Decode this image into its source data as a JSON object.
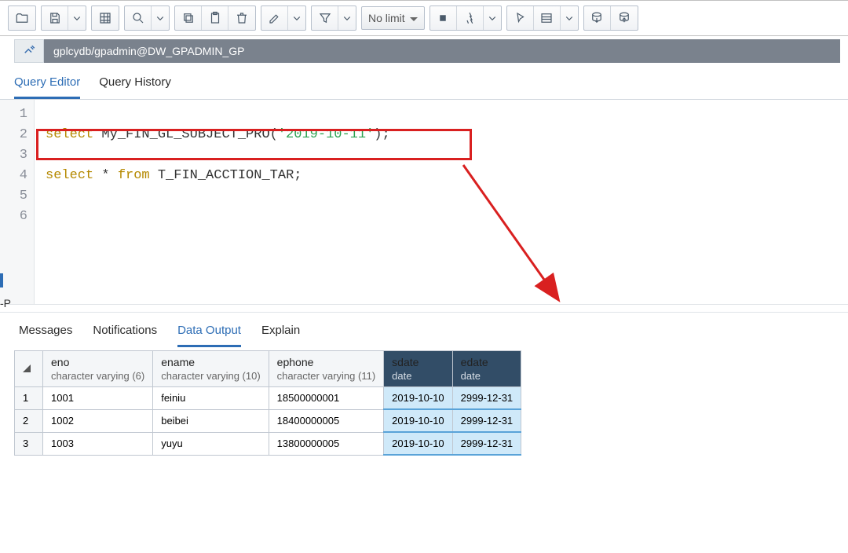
{
  "toolbar": {
    "limit_label": "No limit"
  },
  "connection": {
    "path": "gplcydb/gpadmin@DW_GPADMIN_GP"
  },
  "query_tabs": {
    "editor": "Query Editor",
    "history": "Query History"
  },
  "editor": {
    "lines": [
      "1",
      "2",
      "3",
      "4",
      "5",
      "6"
    ],
    "line2": {
      "kw": "select",
      "fn": " My_FIN_GL_SUBJECT_PRO(",
      "arg": "'2019-10-11'",
      "end": ");"
    },
    "line4": {
      "kw1": "select",
      "mid": " * ",
      "kw2": "from",
      "tbl": " T_FIN_ACCTION_TAR;"
    }
  },
  "result_tabs": {
    "messages": "Messages",
    "notifications": "Notifications",
    "data_output": "Data Output",
    "explain": "Explain"
  },
  "columns": [
    {
      "name": "eno",
      "type": "character varying (6)",
      "selected": false
    },
    {
      "name": "ename",
      "type": "character varying (10)",
      "selected": false
    },
    {
      "name": "ephone",
      "type": "character varying (11)",
      "selected": false
    },
    {
      "name": "sdate",
      "type": "date",
      "selected": true
    },
    {
      "name": "edate",
      "type": "date",
      "selected": true
    }
  ],
  "rows": [
    {
      "n": "1",
      "eno": "1001",
      "ename": "feiniu",
      "ephone": "18500000001",
      "sdate": "2019-10-10",
      "edate": "2999-12-31"
    },
    {
      "n": "2",
      "eno": "1002",
      "ename": "beibei",
      "ephone": "18400000005",
      "sdate": "2019-10-10",
      "edate": "2999-12-31"
    },
    {
      "n": "3",
      "eno": "1003",
      "ename": "yuyu",
      "ephone": "13800000005",
      "sdate": "2019-10-10",
      "edate": "2999-12-31"
    }
  ],
  "stub": "-P"
}
